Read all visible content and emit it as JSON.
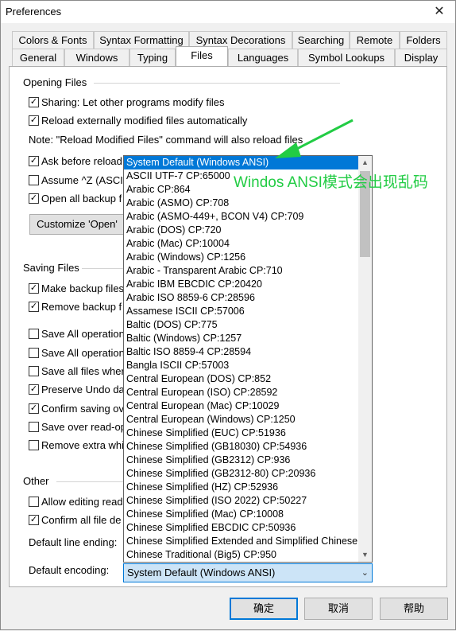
{
  "window": {
    "title": "Preferences",
    "close_glyph": "✕"
  },
  "tabs_row1": [
    "Colors & Fonts",
    "Syntax Formatting",
    "Syntax Decorations",
    "Searching",
    "Remote",
    "Folders"
  ],
  "tabs_row2": [
    "General",
    "Windows",
    "Typing",
    "Files",
    "Languages",
    "Symbol Lookups",
    "Display"
  ],
  "active_tab": "Files",
  "opening_files": {
    "title": "Opening Files",
    "items": [
      {
        "label": "Sharing: Let other programs modify files",
        "checked": true
      },
      {
        "label": "Reload externally modified files automatically",
        "checked": true
      }
    ],
    "note": "Note: \"Reload Modified Files\" command will also reload files",
    "items2": [
      {
        "label": "Ask before reload",
        "checked": true
      },
      {
        "label": "Assume ^Z (ASCII",
        "checked": false
      },
      {
        "label": "Open all backup f",
        "checked": true
      }
    ],
    "customize_button": "Customize 'Open'"
  },
  "saving_files": {
    "title": "Saving Files",
    "items": [
      {
        "label": "Make backup files",
        "checked": true
      },
      {
        "label": "Remove backup f",
        "checked": true
      },
      {
        "label": "Save All operation",
        "checked": false
      },
      {
        "label": "Save All operation",
        "checked": false
      },
      {
        "label": "Save all files wher",
        "checked": false
      },
      {
        "label": "Preserve Undo da",
        "checked": true
      },
      {
        "label": "Confirm saving ov",
        "checked": true
      },
      {
        "label": "Save over read-op",
        "checked": false
      },
      {
        "label": "Remove extra whi",
        "checked": false
      }
    ]
  },
  "other": {
    "title": "Other",
    "items": [
      {
        "label": "Allow editing read",
        "checked": false
      },
      {
        "label": "Confirm all file de",
        "checked": true
      }
    ],
    "line_ending_label": "Default line ending:",
    "encoding_label": "Default encoding:",
    "encoding_value": "System Default (Windows ANSI)"
  },
  "dropdown": {
    "items": [
      "System Default (Windows ANSI)",
      "ASCII UTF-7  CP:65000",
      "Arabic  CP:864",
      "Arabic (ASMO)  CP:708",
      "Arabic (ASMO-449+, BCON V4)  CP:709",
      "Arabic (DOS)  CP:720",
      "Arabic (Mac)  CP:10004",
      "Arabic (Windows)  CP:1256",
      "Arabic - Transparent Arabic  CP:710",
      "Arabic IBM EBCDIC  CP:20420",
      "Arabic ISO 8859-6  CP:28596",
      "Assamese ISCII  CP:57006",
      "Baltic (DOS)  CP:775",
      "Baltic (Windows)  CP:1257",
      "Baltic ISO 8859-4  CP:28594",
      "Bangla ISCII  CP:57003",
      "Central European (DOS)  CP:852",
      "Central European (ISO)  CP:28592",
      "Central European (Mac)  CP:10029",
      "Central European (Windows)  CP:1250",
      "Chinese Simplified (EUC)  CP:51936",
      "Chinese Simplified (GB18030)  CP:54936",
      "Chinese Simplified (GB2312)  CP:936",
      "Chinese Simplified (GB2312-80)  CP:20936",
      "Chinese Simplified (HZ)  CP:52936",
      "Chinese Simplified (ISO 2022)  CP:50227",
      "Chinese Simplified (Mac)  CP:10008",
      "Chinese Simplified EBCDIC  CP:50936",
      "Chinese Simplified Extended and Simplified Chinese",
      "Chinese Traditional (Big5)  CP:950"
    ],
    "selected_index": 0,
    "scroll_up": "▲",
    "scroll_down": "▼",
    "combo_arrow": "⌄"
  },
  "annotation": {
    "text": "Windos ANSI模式会出现乱码",
    "color": "#22cc44"
  },
  "footer": {
    "ok": "确定",
    "cancel": "取消",
    "help": "帮助"
  },
  "colors": {
    "accent": "#0078d7",
    "selection": "#0078d7",
    "annotation": "#22cc44"
  }
}
